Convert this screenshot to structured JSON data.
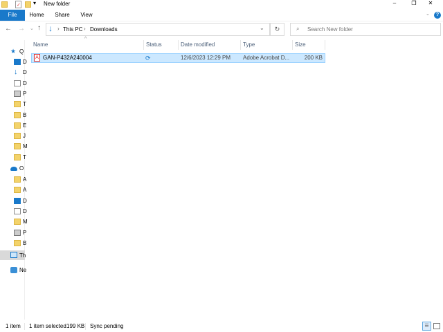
{
  "window": {
    "title": "New folder"
  },
  "ribbon": {
    "tabs": [
      "File",
      "Home",
      "Share",
      "View"
    ]
  },
  "address": {
    "path": [
      "This PC",
      "Downloads"
    ],
    "search_placeholder": "Search New folder"
  },
  "columns": [
    "Name",
    "Status",
    "Date modified",
    "Type",
    "Size"
  ],
  "files": [
    {
      "name": "GAN-P432A240004",
      "status": "sync-pending-icon",
      "date": "12/6/2023 12:29 PM",
      "type": "Adobe Acrobat D...",
      "size": "200 KB",
      "selected": true
    }
  ],
  "nav": {
    "quick_access": {
      "label": "Q",
      "items": [
        {
          "icon": "desktop",
          "label": "D"
        },
        {
          "icon": "downloads",
          "label": "D"
        },
        {
          "icon": "documents",
          "label": "D"
        },
        {
          "icon": "pictures",
          "label": "P"
        },
        {
          "icon": "folder",
          "label": "T"
        },
        {
          "icon": "folder",
          "label": "B"
        },
        {
          "icon": "folder",
          "label": "E"
        },
        {
          "icon": "folder",
          "label": "J"
        },
        {
          "icon": "folder",
          "label": "M"
        },
        {
          "icon": "folder",
          "label": "T"
        }
      ]
    },
    "onedrive": {
      "label": "O",
      "items": [
        {
          "icon": "folder",
          "label": "A"
        },
        {
          "icon": "folder",
          "label": "A"
        },
        {
          "icon": "desktop",
          "label": "D"
        },
        {
          "icon": "documents",
          "label": "D"
        },
        {
          "icon": "folder",
          "label": "M"
        },
        {
          "icon": "pictures",
          "label": "P"
        },
        {
          "icon": "folder",
          "label": "B"
        }
      ]
    },
    "this_pc": "Th",
    "network": "Ne"
  },
  "status_bar": {
    "count": "1 item",
    "selected": "1 item selected",
    "size": "199 KB",
    "sync": "Sync pending"
  },
  "colors": {
    "accent": "#1979ca",
    "selection": "#cce8ff"
  }
}
